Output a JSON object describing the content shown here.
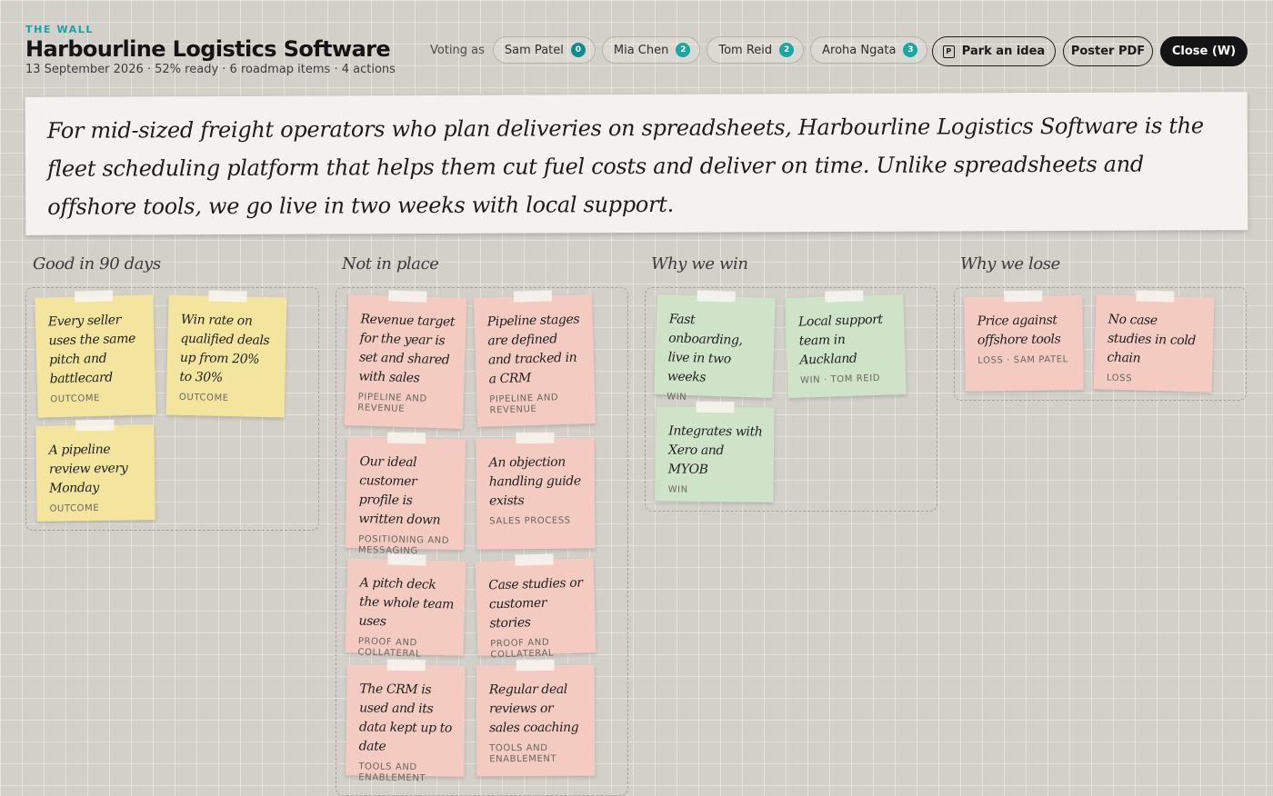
{
  "header": {
    "eyebrow": "THE WALL",
    "title": "Harbourline Logistics Software",
    "meta": "13 September 2026 · 52% ready · 6 roadmap items · 4 actions"
  },
  "voting": {
    "label": "Voting as",
    "voters": [
      {
        "name": "Sam Patel",
        "count": "0"
      },
      {
        "name": "Mia Chen",
        "count": "2"
      },
      {
        "name": "Tom Reid",
        "count": "2"
      },
      {
        "name": "Aroha Ngata",
        "count": "3"
      }
    ]
  },
  "actions": {
    "park_label": "Park an idea",
    "park_icon": "P",
    "poster_label": "Poster PDF",
    "close_label": "Close (W)"
  },
  "statement": "For mid-sized freight operators who plan deliveries on spreadsheets, Harbourline Logistics Software is the fleet scheduling platform that helps them cut fuel costs and deliver on time. Unlike spreadsheets and offshore tools, we go live in two weeks with local support.",
  "columns": [
    {
      "heading": "Good in 90 days",
      "color": "#f3e59d",
      "notes": [
        {
          "text": "Every seller uses the same pitch and battlecard",
          "tag": "OUTCOME"
        },
        {
          "text": "Win rate on qualified deals up from 20% to 30%",
          "tag": "OUTCOME"
        },
        {
          "text": "A pipeline review every Monday",
          "tag": "OUTCOME"
        }
      ]
    },
    {
      "heading": "Not in place",
      "color": "#f3cbc1",
      "notes": [
        {
          "text": "Revenue target for the year is set and shared with sales",
          "tag": "PIPELINE AND REVENUE"
        },
        {
          "text": "Pipeline stages are defined and tracked in a CRM",
          "tag": "PIPELINE AND REVENUE"
        },
        {
          "text": "Our ideal customer profile is written down",
          "tag": "POSITIONING AND MESSAGING"
        },
        {
          "text": "An objection handling guide exists",
          "tag": "SALES PROCESS"
        },
        {
          "text": "A pitch deck the whole team uses",
          "tag": "PROOF AND COLLATERAL"
        },
        {
          "text": "Case studies or customer stories",
          "tag": "PROOF AND COLLATERAL"
        },
        {
          "text": "The CRM is used and its data kept up to date",
          "tag": "TOOLS AND ENABLEMENT"
        },
        {
          "text": "Regular deal reviews or sales coaching",
          "tag": "TOOLS AND ENABLEMENT"
        }
      ]
    },
    {
      "heading": "Why we win",
      "color": "#cfe3c9",
      "notes": [
        {
          "text": "Fast onboarding, live in two weeks",
          "tag": "WIN"
        },
        {
          "text": "Local support team in Auckland",
          "tag": "WIN · TOM REID"
        },
        {
          "text": "Integrates with Xero and MYOB",
          "tag": "WIN"
        }
      ]
    },
    {
      "heading": "Why we lose",
      "color": "#f3cbc1",
      "notes": [
        {
          "text": "Price against offshore tools",
          "tag": "LOSS · SAM PATEL"
        },
        {
          "text": "No case studies in cold chain",
          "tag": "LOSS"
        }
      ]
    }
  ]
}
